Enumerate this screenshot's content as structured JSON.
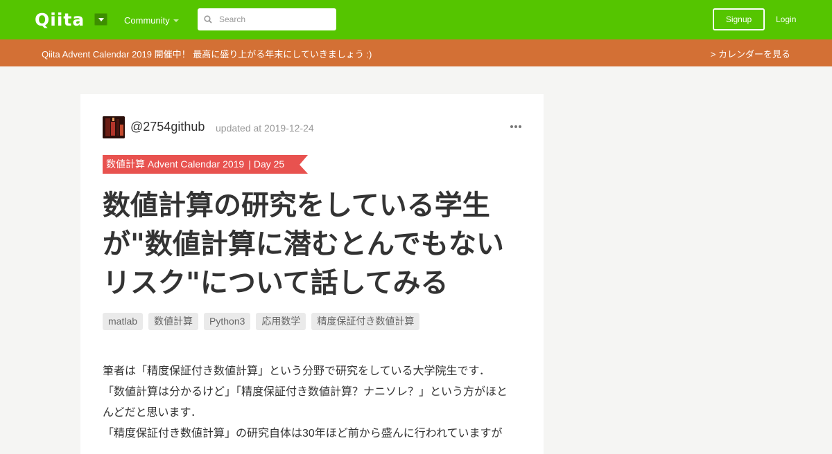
{
  "header": {
    "logo": "Qiita",
    "community_label": "Community",
    "search_placeholder": "Search",
    "signup_label": "Signup",
    "login_label": "Login",
    "brand_color": "#55c500"
  },
  "banner": {
    "text": "Qiita Advent Calendar 2019 開催中！ 最高に盛り上がる年末にしていきましょう :)",
    "link_label": "> カレンダーを見る",
    "color": "#d37035"
  },
  "article": {
    "author": "@2754github",
    "updated": "updated at 2019-12-24",
    "advent_calendar": "数値計算 Advent Calendar 2019",
    "advent_day": "Day 25",
    "title": "数値計算の研究をしている学生が\"数値計算に潜むとんでもないリスク\"について話してみる",
    "tags": [
      "matlab",
      "数値計算",
      "Python3",
      "応用数学",
      "精度保証付き数値計算"
    ],
    "body_lines": [
      "筆者は「精度保証付き数値計算」という分野で研究をしている大学院生です．",
      "「数値計算は分かるけど」「精度保証付き数値計算？ナニソレ？」という方がほと",
      "んどだと思います．",
      "「精度保証付き数値計算」の研究自体は30年ほど前から盛んに行われていますが"
    ]
  }
}
